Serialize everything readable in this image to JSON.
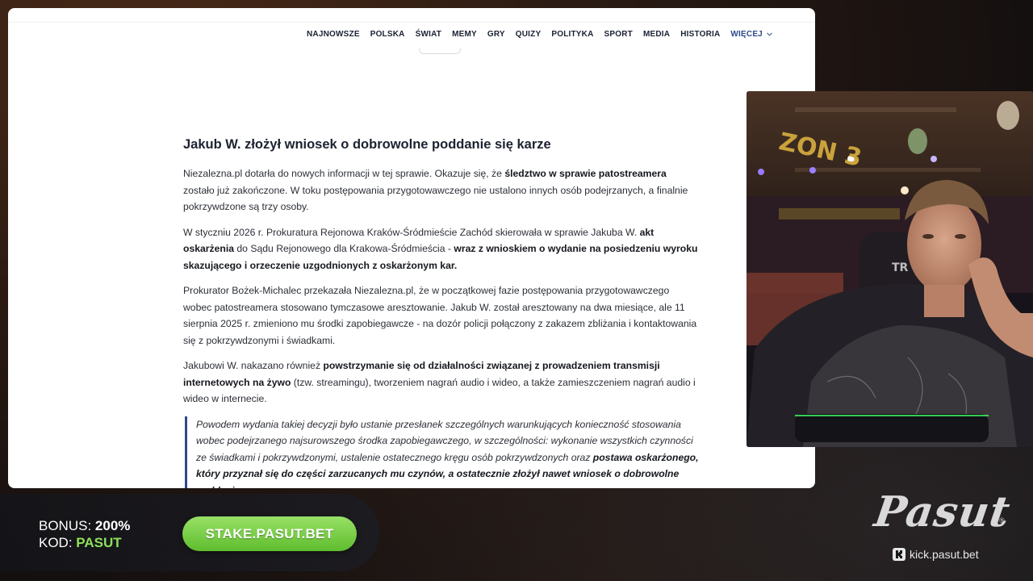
{
  "nav": {
    "items": [
      "NAJNOWSZE",
      "POLSKA",
      "ŚWIAT",
      "MEMY",
      "GRY",
      "QUIZY",
      "POLITYKA",
      "SPORT",
      "MEDIA",
      "HISTORIA"
    ],
    "more_label": "WIĘCEJ"
  },
  "article": {
    "heading": "Jakub W. złożył wniosek o dobrowolne poddanie się karze",
    "p1": {
      "a": "Niezalezna.pl dotarła do nowych informacji w tej sprawie. Okazuje się, że ",
      "b": "śledztwo w sprawie patostreamera",
      "c": " zostało już zakończone. W toku postępowania przygotowawczego nie ustalono innych osób podejrzanych, a finalnie pokrzywdzone są trzy osoby."
    },
    "p2": {
      "a": "W styczniu 2026 r. Prokuratura Rejonowa Kraków-Śródmieście Zachód skierowała w sprawie Jakuba W. ",
      "b": "akt oskarżenia",
      "c": " do Sądu Rejonowego dla Krakowa-Śródmieścia - ",
      "d": "wraz z wnioskiem o wydanie na posiedzeniu wyroku skazującego i orzeczenie uzgodnionych z oskarżonym kar."
    },
    "p3": "Prokurator Bożek-Michalec przekazała Niezalezna.pl, że w początkowej fazie postępowania przygotowawczego wobec patostreamera stosowano tymczasowe aresztowanie. Jakub W. został aresztowany na dwa miesiące, ale 11 sierpnia 2025 r. zmieniono mu środki zapobiegawcze - na dozór policji połączony z zakazem zbliżania i kontaktowania się z pokrzywdzonymi i świadkami.",
    "p4": {
      "a": "Jakubowi W. nakazano również ",
      "b": "powstrzymanie się od działalności związanej z prowadzeniem transmisji internetowych na żywo",
      "c": " (tzw. streamingu), tworzeniem nagrań audio i wideo, a także zamieszczeniem nagrań audio i wideo w internecie."
    },
    "quote": {
      "a": "Powodem wydania takiej decyzji było ustanie przesłanek szczególnych warunkujących konieczność stosowania wobec podejrzanego najsurowszego środka zapobiegawczego, w szczególności: wykonanie wszystkich czynności ze świadkami i pokrzywdzonymi, ustalenie ostatecznego kręgu osób pokrzywdzonych oraz ",
      "b": "postawa oskarżonego, który przyznał się do części zarzucanych mu czynów, a ostatecznie złożył nawet wniosek o dobrowolne poddanie"
    }
  },
  "overlay": {
    "bonus_label": "BONUS:",
    "bonus_value": "200%",
    "code_label": "KOD:",
    "code_value": "PASUT",
    "stake_button": "STAKE.PASUT.BET",
    "brand": "Pasut",
    "reg_mark": "®",
    "kick_url": "kick.pasut.bet",
    "colors": {
      "accent_green": "#8ee05a",
      "nav_more": "#2f4a8a"
    }
  },
  "webcam": {
    "wall_text": "ZON 3"
  }
}
